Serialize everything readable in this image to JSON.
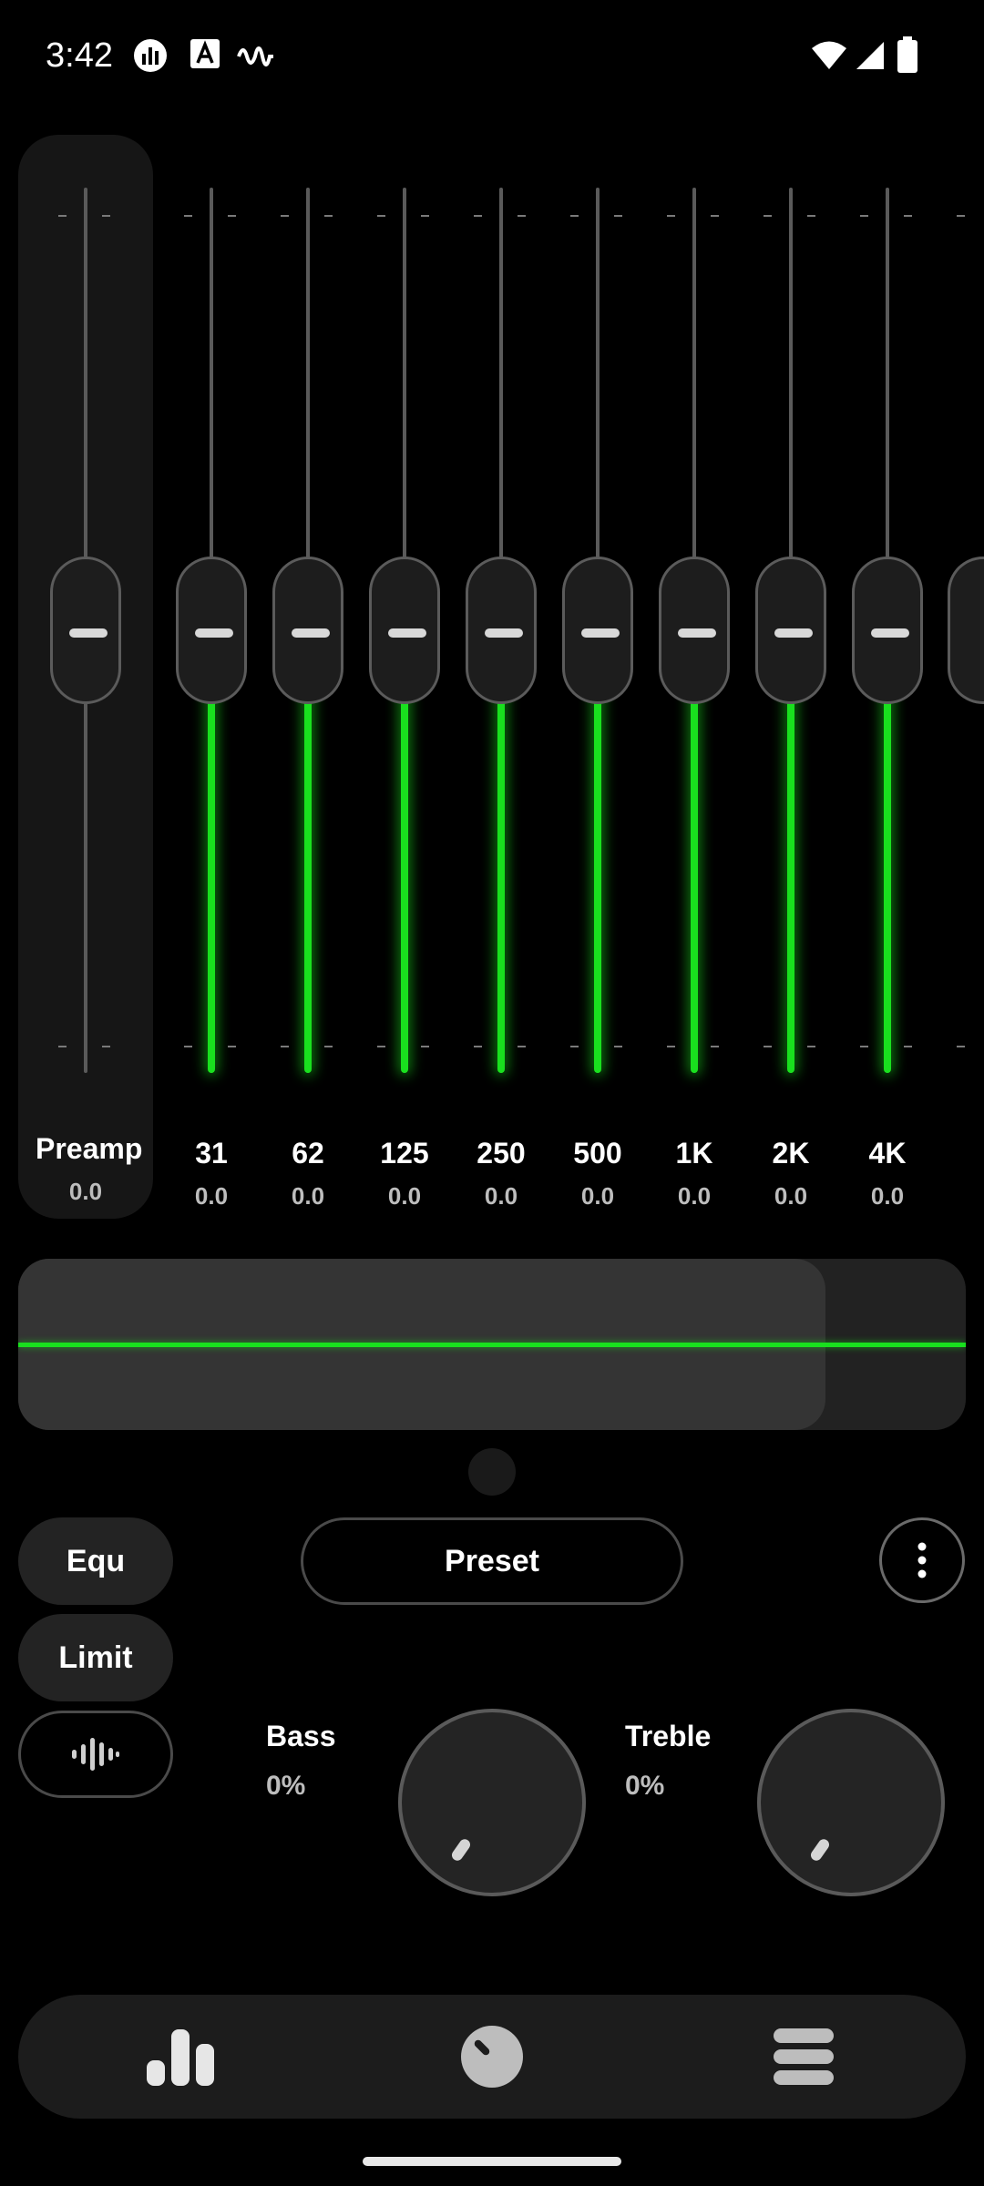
{
  "status_bar": {
    "time": "3:42",
    "icons": [
      "equalizer-app-icon",
      "a-badge-icon",
      "waveform-icon",
      "wifi-icon",
      "signal-icon",
      "battery-icon"
    ]
  },
  "preamp": {
    "label": "Preamp",
    "value": "0.0",
    "level": 0.5
  },
  "bands": [
    {
      "label": "31",
      "value": "0.0",
      "level": 0.5
    },
    {
      "label": "62",
      "value": "0.0",
      "level": 0.5
    },
    {
      "label": "125",
      "value": "0.0",
      "level": 0.5
    },
    {
      "label": "250",
      "value": "0.0",
      "level": 0.5
    },
    {
      "label": "500",
      "value": "0.0",
      "level": 0.5
    },
    {
      "label": "1K",
      "value": "0.0",
      "level": 0.5
    },
    {
      "label": "2K",
      "value": "0.0",
      "level": 0.5
    },
    {
      "label": "4K",
      "value": "0.0",
      "level": 0.5
    }
  ],
  "controls": {
    "equ_label": "Equ",
    "limit_label": "Limit",
    "preset_label": "Preset",
    "more_icon": "more-vertical-icon",
    "visualizer_icon": "audio-bars-icon"
  },
  "bass": {
    "label": "Bass",
    "value": "0%",
    "level": 0
  },
  "treble": {
    "label": "Treble",
    "value": "0%",
    "level": 0
  },
  "nav": {
    "items": [
      "equalizer-nav-icon",
      "dial-nav-icon",
      "stack-nav-icon"
    ]
  },
  "colors": {
    "accent": "#19e01e",
    "background": "#000000",
    "surface": "#1c1c1c"
  }
}
